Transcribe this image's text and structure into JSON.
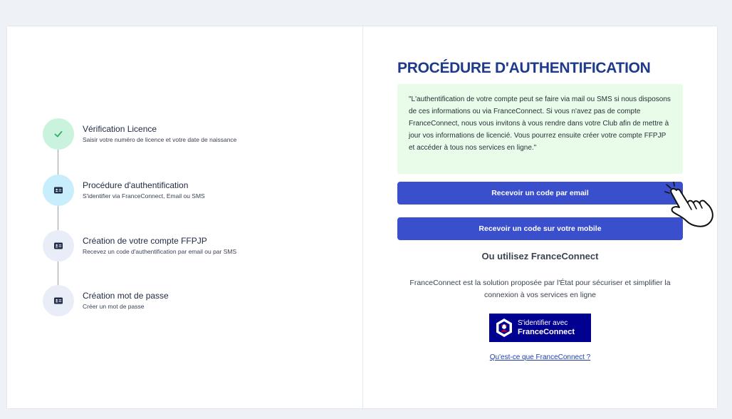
{
  "stepper": {
    "steps": [
      {
        "title": "Vérification Licence",
        "subtitle": "Saisir votre numéro de licence et votre date de naissance",
        "icon": "check-icon",
        "state": "done"
      },
      {
        "title": "Procédure d'authentification",
        "subtitle": "S'identifier via FranceConnect, Email ou SMS",
        "icon": "id-card-icon",
        "state": "active"
      },
      {
        "title": "Création de votre compte FFPJP",
        "subtitle": "Recevez un code d'authentification par email ou par SMS",
        "icon": "id-card-icon",
        "state": "pending"
      },
      {
        "title": "Création mot de passe",
        "subtitle": "Créer un mot de passe",
        "icon": "id-card-icon",
        "state": "pending"
      }
    ]
  },
  "auth": {
    "title": "PROCÉDURE D'AUTHENTIFICATION",
    "info": "\"L'authentification de votre compte peut se faire via mail ou SMS si nous disposons de ces informations ou via FranceConnect. Si vous n'avez pas de compte FranceConnect, nous vous invitons à vous rendre dans votre Club afin de mettre à jour vos informations de licencié. Vous pourrez ensuite créer votre compte FFPJP et accéder à tous nos services en ligne.\"",
    "email_button": "Recevoir un code par email",
    "mobile_button": "Recevoir un code sur votre mobile",
    "alt_title": "Ou utilisez FranceConnect",
    "alt_desc": "FranceConnect est la solution proposée par l'État pour sécuriser et simplifier la connexion à vos services en ligne",
    "fc_line1": "S'identifier avec",
    "fc_line2": "FranceConnect",
    "fc_link": "Qu'est-ce que FranceConnect ?"
  },
  "colors": {
    "primary": "#3a4fcc",
    "title": "#1e3a8a",
    "info_bg": "#e8fce9",
    "step_done": "#c9f3dc",
    "step_active": "#c8eefb",
    "step_pending": "#e8edf7",
    "franceconnect": "#000091"
  }
}
